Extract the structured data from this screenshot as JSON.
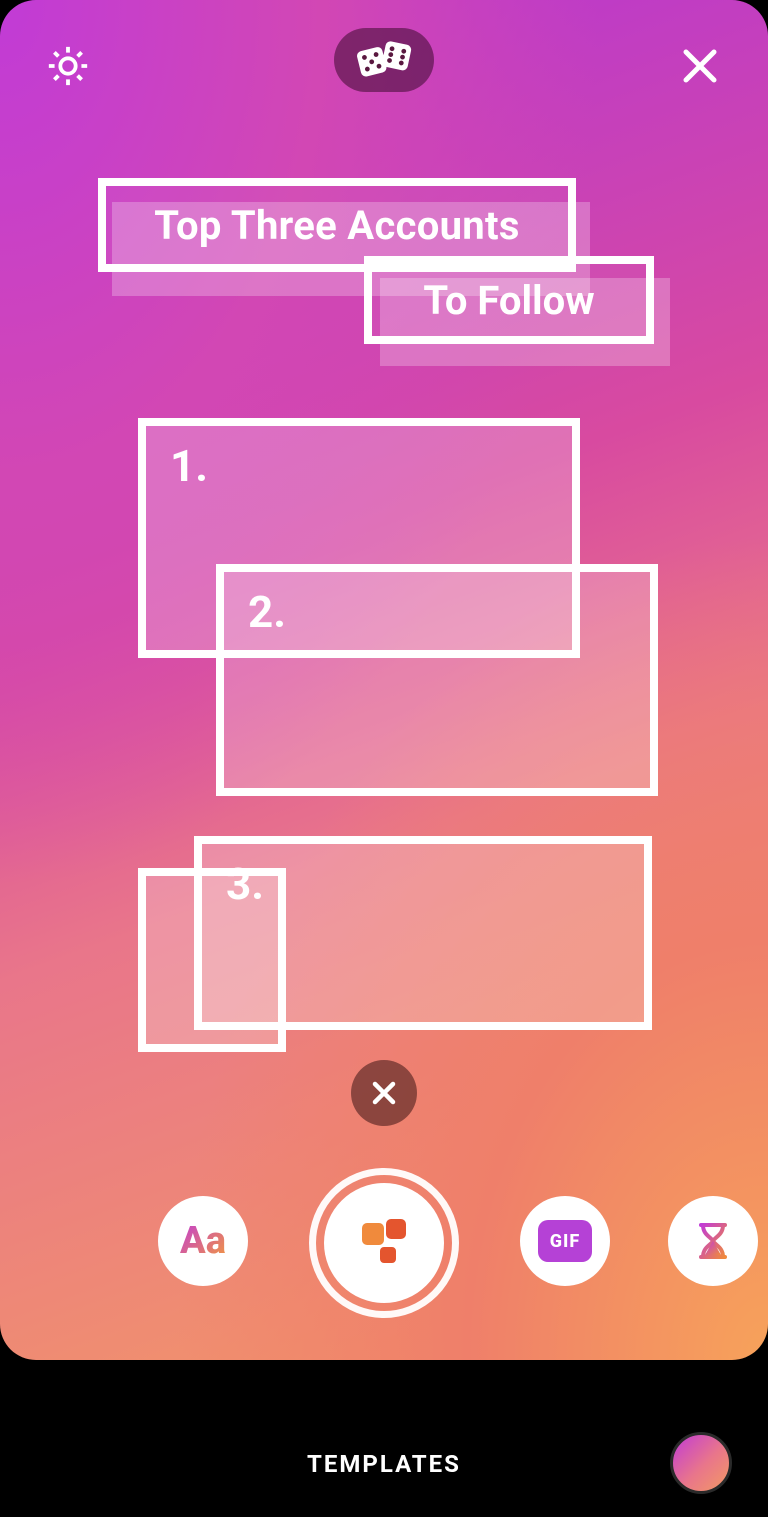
{
  "template": {
    "title_line1": "Top Three Accounts",
    "title_line2": "To Follow",
    "slots": [
      "1.",
      "2.",
      "3."
    ]
  },
  "tools": {
    "text_label": "Aa",
    "gif_label": "GIF"
  },
  "footer": {
    "mode_label": "TEMPLATES"
  }
}
